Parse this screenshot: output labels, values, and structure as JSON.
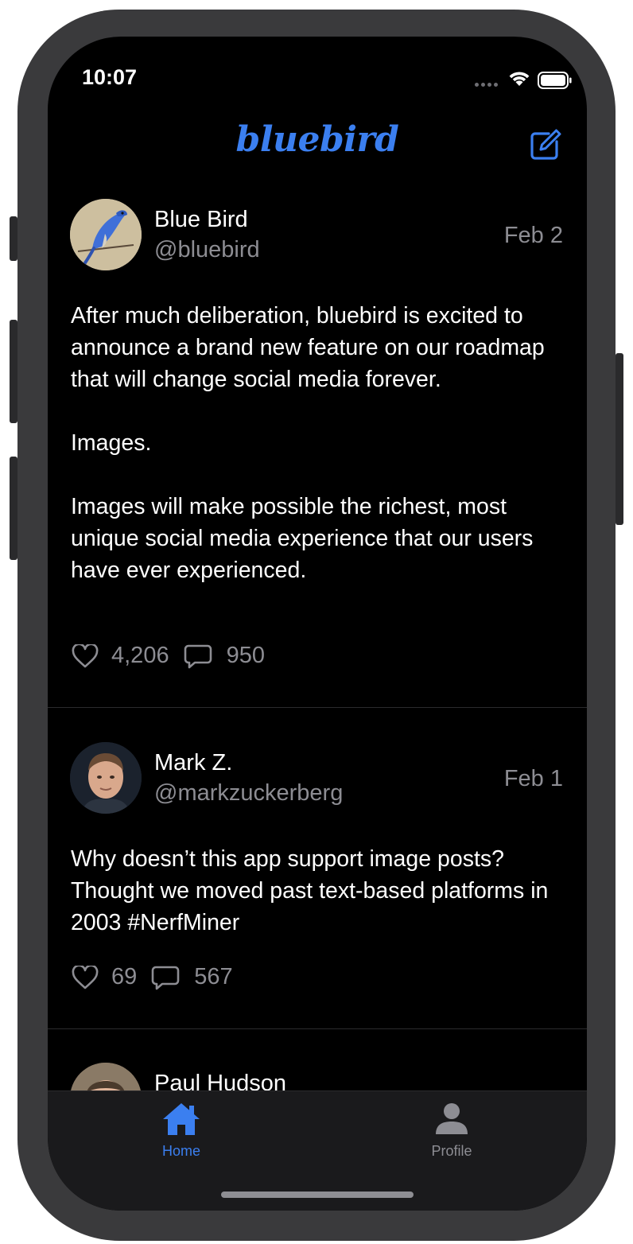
{
  "status_bar": {
    "time": "10:07"
  },
  "header": {
    "title": "bluebird",
    "compose_icon": "compose-icon"
  },
  "colors": {
    "accent": "#3b7ff0",
    "background": "#000000",
    "secondary_text": "#8d8d93"
  },
  "posts": [
    {
      "name": "Blue Bird",
      "handle": "@bluebird",
      "date": "Feb 2",
      "paragraphs": [
        "After much deliberation, bluebird is excited to announce a brand new feature on our roadmap that will change social media forever.",
        "Images.",
        "Images will make possible the richest, most unique social media experience that our users have ever experienced."
      ],
      "likes": "4,206",
      "comments": "950"
    },
    {
      "name": "Mark Z.",
      "handle": "@markzuckerberg",
      "date": "Feb 1",
      "paragraphs": [
        "Why doesn’t this app support image posts? Thought we moved past text-based platforms in 2003  #NerfMiner"
      ],
      "likes": "69",
      "comments": "567"
    },
    {
      "name": "Paul Hudson"
    }
  ],
  "tab_bar": {
    "items": [
      {
        "label": "Home",
        "icon": "home-icon",
        "selected": true
      },
      {
        "label": "Profile",
        "icon": "profile-icon",
        "selected": false
      }
    ]
  }
}
